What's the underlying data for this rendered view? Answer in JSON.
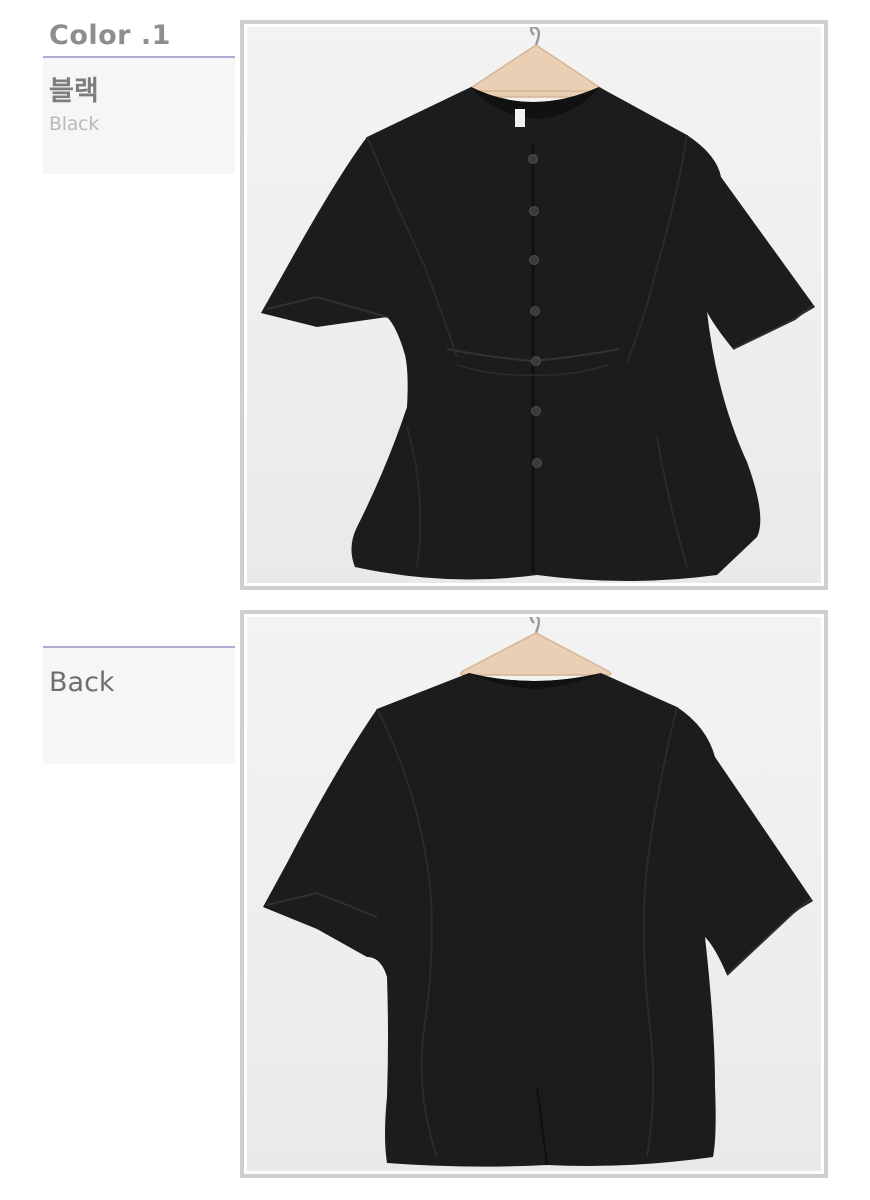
{
  "color_section": {
    "title": "Color .1",
    "korean_name": "블랙",
    "english_name": "Black"
  },
  "back_section": {
    "label": "Back"
  },
  "colors": {
    "accent_rule": "#b4aad1",
    "garment": "#1c1c1e",
    "hanger": "#e9cfb3"
  }
}
